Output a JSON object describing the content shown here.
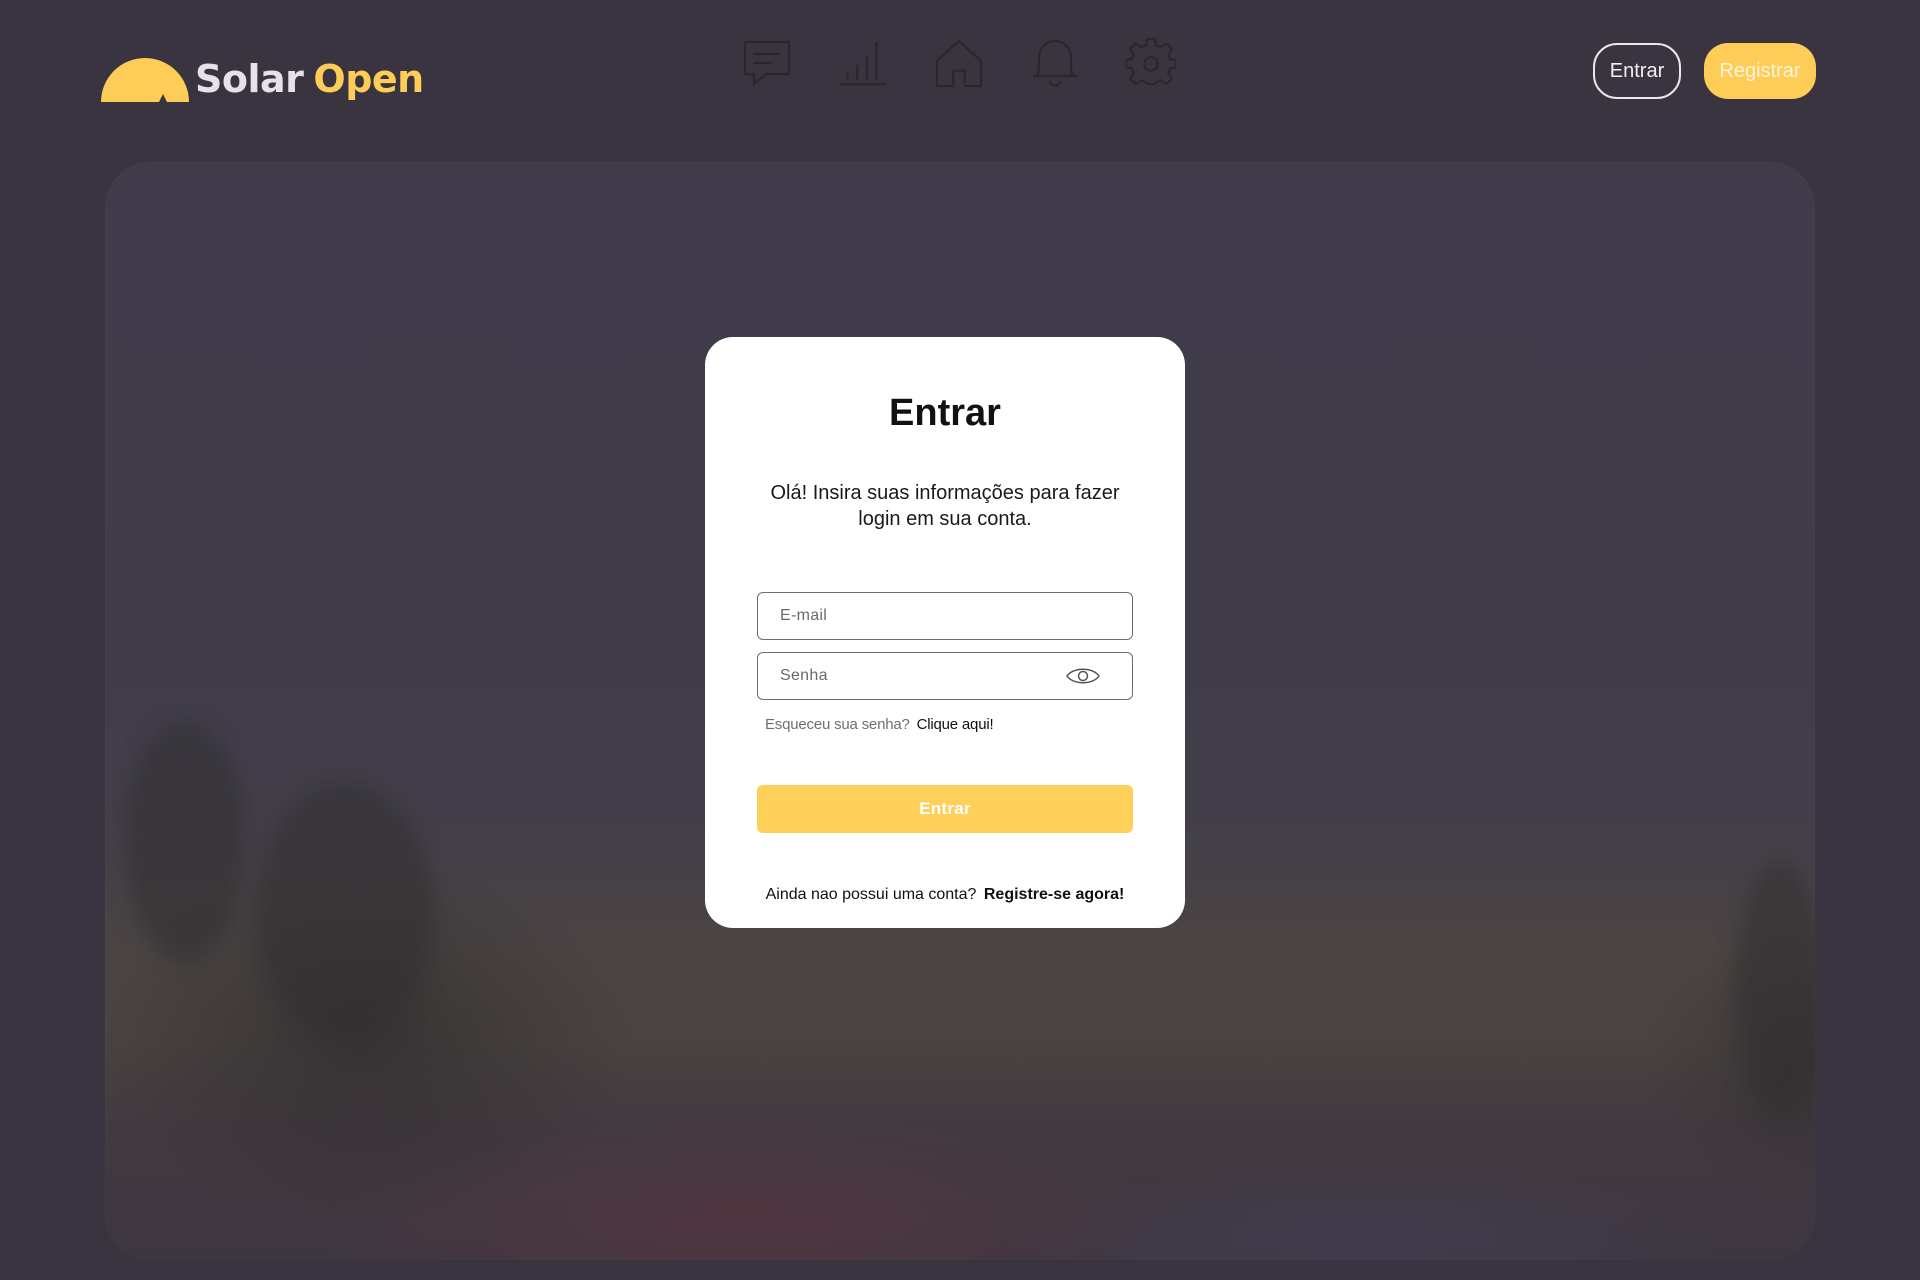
{
  "app": {
    "brand_word_1": "Solar",
    "brand_word_2": "Open",
    "logo_icon": "sun-rising-icon",
    "colors": {
      "background": "#393440",
      "accent": "#fecd57",
      "card": "#ffffff"
    }
  },
  "nav": {
    "icons": [
      "chat-icon",
      "bar-chart-icon",
      "home-icon",
      "bell-icon",
      "gear-icon"
    ]
  },
  "header": {
    "login_label": "Entrar",
    "register_label": "Registrar"
  },
  "login": {
    "title": "Entrar",
    "subtitle": "Olá! Insira suas informações para fazer login em sua conta.",
    "email_placeholder": "E-mail",
    "password_placeholder": "Senha",
    "password_toggle_icon": "eye-icon",
    "forgot_text": "Esqueceu sua senha?",
    "forgot_link": "Clique aqui!",
    "submit_label": "Entrar",
    "no_account_text": "Ainda nao possui uma conta?",
    "register_link": "Registre-se agora!"
  }
}
